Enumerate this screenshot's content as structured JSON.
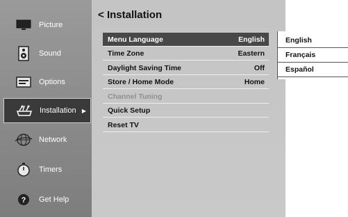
{
  "sidebar": {
    "items": [
      {
        "label": "Picture",
        "icon": "tv-icon"
      },
      {
        "label": "Sound",
        "icon": "speaker-icon"
      },
      {
        "label": "Options",
        "icon": "options-icon"
      },
      {
        "label": "Installation",
        "icon": "installation-icon",
        "selected": true
      },
      {
        "label": "Network",
        "icon": "globe-icon"
      },
      {
        "label": "Timers",
        "icon": "timer-icon"
      },
      {
        "label": "Get Help",
        "icon": "help-icon"
      }
    ]
  },
  "main": {
    "back": "<",
    "title": "Installation",
    "rows": [
      {
        "label": "Menu Language",
        "value": "English"
      },
      {
        "label": "Time Zone",
        "value": "Eastern"
      },
      {
        "label": "Daylight Saving Time",
        "value": "Off"
      },
      {
        "label": "Store / Home Mode",
        "value": "Home"
      },
      {
        "label": "Channel Tuning",
        "value": ""
      },
      {
        "label": "Quick Setup",
        "value": ""
      },
      {
        "label": "Reset TV",
        "value": ""
      }
    ]
  },
  "dropdown": {
    "options": [
      "English",
      "Français",
      "Español"
    ]
  },
  "colors": {
    "sidebar": "#8a8a8a",
    "selected": "#3a3a3a",
    "panel": "#c6c6c6",
    "highlight": "#484848"
  }
}
